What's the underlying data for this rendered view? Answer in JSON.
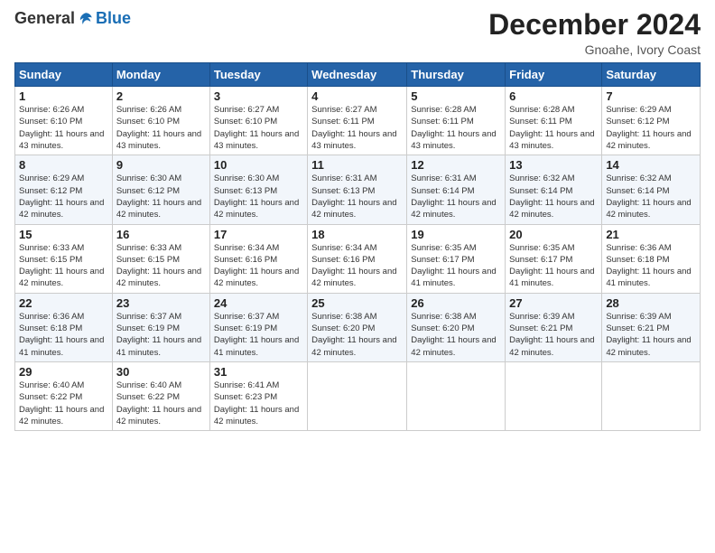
{
  "header": {
    "logo_general": "General",
    "logo_blue": "Blue",
    "title": "December 2024",
    "subtitle": "Gnoahe, Ivory Coast"
  },
  "weekdays": [
    "Sunday",
    "Monday",
    "Tuesday",
    "Wednesday",
    "Thursday",
    "Friday",
    "Saturday"
  ],
  "weeks": [
    [
      {
        "day": "1",
        "sunrise": "6:26 AM",
        "sunset": "6:10 PM",
        "daylight": "11 hours and 43 minutes."
      },
      {
        "day": "2",
        "sunrise": "6:26 AM",
        "sunset": "6:10 PM",
        "daylight": "11 hours and 43 minutes."
      },
      {
        "day": "3",
        "sunrise": "6:27 AM",
        "sunset": "6:10 PM",
        "daylight": "11 hours and 43 minutes."
      },
      {
        "day": "4",
        "sunrise": "6:27 AM",
        "sunset": "6:11 PM",
        "daylight": "11 hours and 43 minutes."
      },
      {
        "day": "5",
        "sunrise": "6:28 AM",
        "sunset": "6:11 PM",
        "daylight": "11 hours and 43 minutes."
      },
      {
        "day": "6",
        "sunrise": "6:28 AM",
        "sunset": "6:11 PM",
        "daylight": "11 hours and 43 minutes."
      },
      {
        "day": "7",
        "sunrise": "6:29 AM",
        "sunset": "6:12 PM",
        "daylight": "11 hours and 42 minutes."
      }
    ],
    [
      {
        "day": "8",
        "sunrise": "6:29 AM",
        "sunset": "6:12 PM",
        "daylight": "11 hours and 42 minutes."
      },
      {
        "day": "9",
        "sunrise": "6:30 AM",
        "sunset": "6:12 PM",
        "daylight": "11 hours and 42 minutes."
      },
      {
        "day": "10",
        "sunrise": "6:30 AM",
        "sunset": "6:13 PM",
        "daylight": "11 hours and 42 minutes."
      },
      {
        "day": "11",
        "sunrise": "6:31 AM",
        "sunset": "6:13 PM",
        "daylight": "11 hours and 42 minutes."
      },
      {
        "day": "12",
        "sunrise": "6:31 AM",
        "sunset": "6:14 PM",
        "daylight": "11 hours and 42 minutes."
      },
      {
        "day": "13",
        "sunrise": "6:32 AM",
        "sunset": "6:14 PM",
        "daylight": "11 hours and 42 minutes."
      },
      {
        "day": "14",
        "sunrise": "6:32 AM",
        "sunset": "6:14 PM",
        "daylight": "11 hours and 42 minutes."
      }
    ],
    [
      {
        "day": "15",
        "sunrise": "6:33 AM",
        "sunset": "6:15 PM",
        "daylight": "11 hours and 42 minutes."
      },
      {
        "day": "16",
        "sunrise": "6:33 AM",
        "sunset": "6:15 PM",
        "daylight": "11 hours and 42 minutes."
      },
      {
        "day": "17",
        "sunrise": "6:34 AM",
        "sunset": "6:16 PM",
        "daylight": "11 hours and 42 minutes."
      },
      {
        "day": "18",
        "sunrise": "6:34 AM",
        "sunset": "6:16 PM",
        "daylight": "11 hours and 42 minutes."
      },
      {
        "day": "19",
        "sunrise": "6:35 AM",
        "sunset": "6:17 PM",
        "daylight": "11 hours and 41 minutes."
      },
      {
        "day": "20",
        "sunrise": "6:35 AM",
        "sunset": "6:17 PM",
        "daylight": "11 hours and 41 minutes."
      },
      {
        "day": "21",
        "sunrise": "6:36 AM",
        "sunset": "6:18 PM",
        "daylight": "11 hours and 41 minutes."
      }
    ],
    [
      {
        "day": "22",
        "sunrise": "6:36 AM",
        "sunset": "6:18 PM",
        "daylight": "11 hours and 41 minutes."
      },
      {
        "day": "23",
        "sunrise": "6:37 AM",
        "sunset": "6:19 PM",
        "daylight": "11 hours and 41 minutes."
      },
      {
        "day": "24",
        "sunrise": "6:37 AM",
        "sunset": "6:19 PM",
        "daylight": "11 hours and 41 minutes."
      },
      {
        "day": "25",
        "sunrise": "6:38 AM",
        "sunset": "6:20 PM",
        "daylight": "11 hours and 42 minutes."
      },
      {
        "day": "26",
        "sunrise": "6:38 AM",
        "sunset": "6:20 PM",
        "daylight": "11 hours and 42 minutes."
      },
      {
        "day": "27",
        "sunrise": "6:39 AM",
        "sunset": "6:21 PM",
        "daylight": "11 hours and 42 minutes."
      },
      {
        "day": "28",
        "sunrise": "6:39 AM",
        "sunset": "6:21 PM",
        "daylight": "11 hours and 42 minutes."
      }
    ],
    [
      {
        "day": "29",
        "sunrise": "6:40 AM",
        "sunset": "6:22 PM",
        "daylight": "11 hours and 42 minutes."
      },
      {
        "day": "30",
        "sunrise": "6:40 AM",
        "sunset": "6:22 PM",
        "daylight": "11 hours and 42 minutes."
      },
      {
        "day": "31",
        "sunrise": "6:41 AM",
        "sunset": "6:23 PM",
        "daylight": "11 hours and 42 minutes."
      },
      null,
      null,
      null,
      null
    ]
  ]
}
